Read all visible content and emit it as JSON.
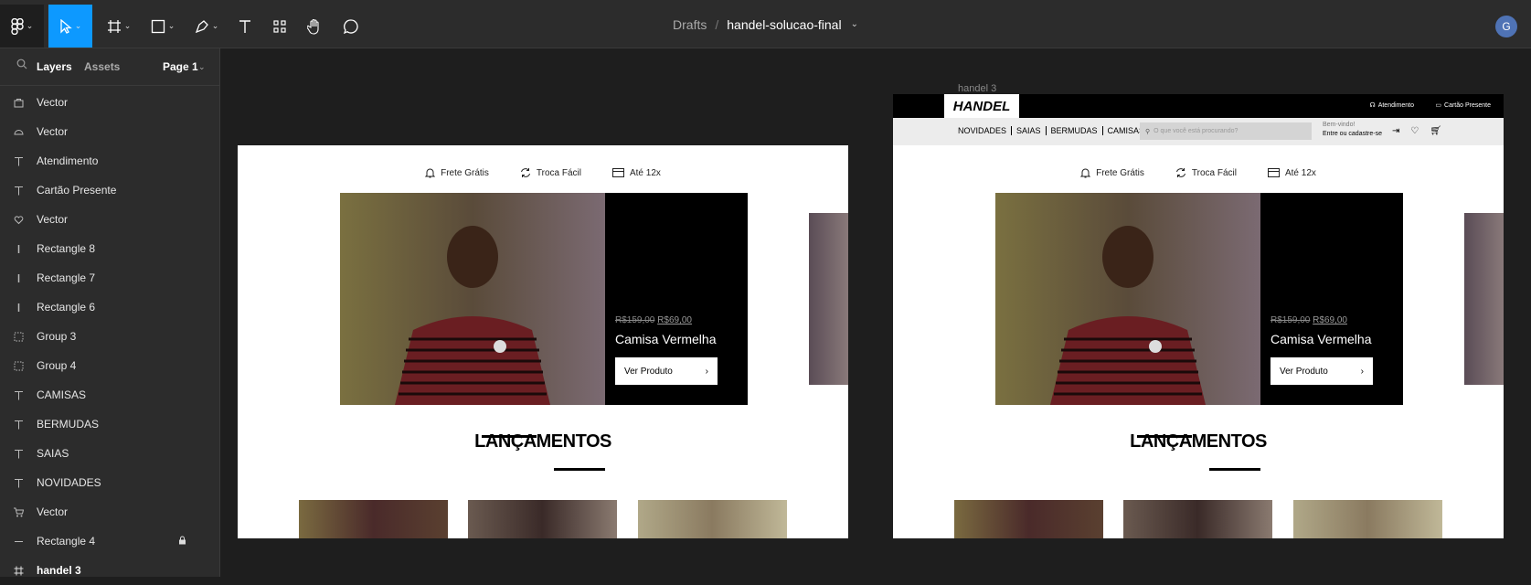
{
  "topbar": {
    "breadcrumb_folder": "Drafts",
    "breadcrumb_sep": "/",
    "file_name": "handel-solucao-final",
    "avatar_initial": "G"
  },
  "sidebar": {
    "tab_layers": "Layers",
    "tab_assets": "Assets",
    "page": "Page 1",
    "layers": [
      {
        "name": "Vector",
        "icon": "vector-icon"
      },
      {
        "name": "Vector",
        "icon": "vector-icon"
      },
      {
        "name": "Atendimento",
        "icon": "text-icon"
      },
      {
        "name": "Cartão Presente",
        "icon": "text-icon"
      },
      {
        "name": "Vector",
        "icon": "heart-icon"
      },
      {
        "name": "Rectangle 8",
        "icon": "rectangle-icon"
      },
      {
        "name": "Rectangle 7",
        "icon": "rectangle-icon"
      },
      {
        "name": "Rectangle 6",
        "icon": "rectangle-icon"
      },
      {
        "name": "Group 3",
        "icon": "group-icon"
      },
      {
        "name": "Group 4",
        "icon": "group-icon"
      },
      {
        "name": "CAMISAS",
        "icon": "text-icon"
      },
      {
        "name": "BERMUDAS",
        "icon": "text-icon"
      },
      {
        "name": "SAIAS",
        "icon": "text-icon"
      },
      {
        "name": "NOVIDADES",
        "icon": "text-icon"
      },
      {
        "name": "Vector",
        "icon": "cart-icon"
      },
      {
        "name": "Rectangle 4",
        "icon": "line-icon",
        "locked": true
      },
      {
        "name": "handel 3",
        "icon": "frame-icon"
      }
    ]
  },
  "canvas": {
    "frame_label": "handel 3",
    "features": [
      "Frete Grátis",
      "Troca Fácil",
      "Até 12x"
    ],
    "hero": {
      "old_price": "R$159,00",
      "new_price": "R$69,00",
      "product_name": "Camisa Vermelha",
      "cta": "Ver Produto"
    },
    "section_title": "LANÇAMENTOS",
    "header": {
      "logo": "HANDEL",
      "atendimento": "Atendimento",
      "cartao": "Cartão Presente",
      "nav": [
        "NOVIDADES",
        "SAIAS",
        "BERMUDAS",
        "CAMISAS"
      ],
      "search_placeholder": "O que você está procurando?",
      "welcome": "Bem-vindo!",
      "login": "Entre ou cadastre-se"
    }
  },
  "colors": {
    "accent": "#0d99ff",
    "panel": "#2c2c2c",
    "canvas_bg": "#1e1e1e"
  }
}
